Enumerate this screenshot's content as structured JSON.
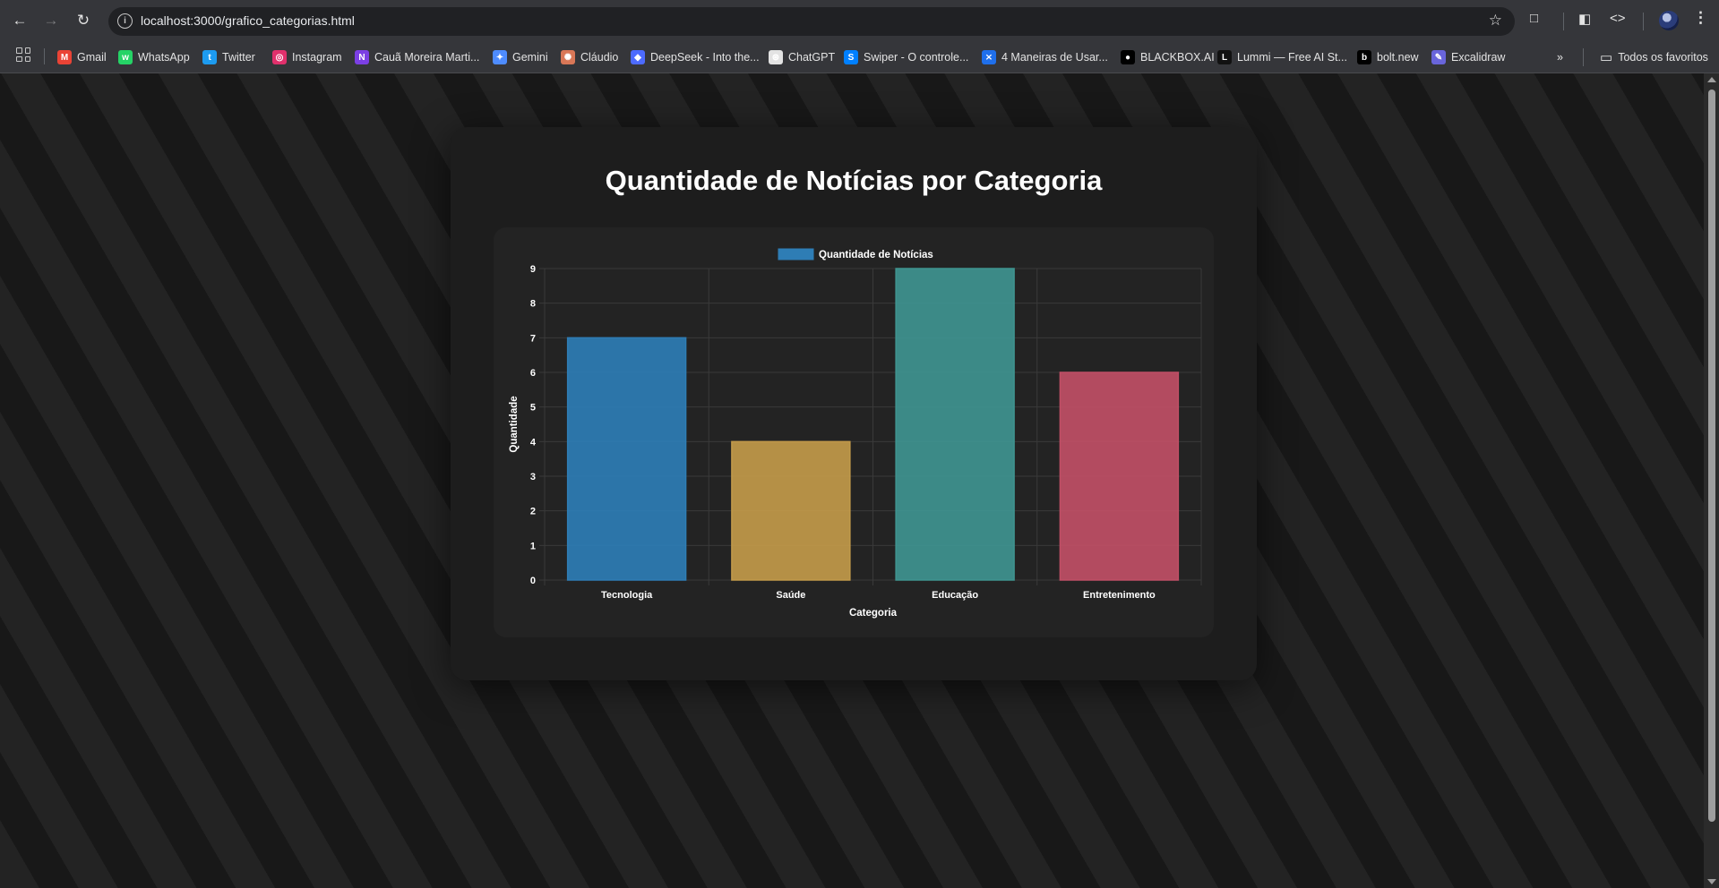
{
  "browser": {
    "url": "localhost:3000/grafico_categorias.html",
    "bookmarks": [
      {
        "label": "Gmail",
        "icon": "gmail-icon",
        "color": "#ea4335"
      },
      {
        "label": "WhatsApp",
        "icon": "whatsapp-icon",
        "color": "#25d366"
      },
      {
        "label": "Twitter",
        "icon": "twitter-icon",
        "color": "#1d9bf0"
      },
      {
        "label": "Instagram",
        "icon": "instagram-icon",
        "color": "#e1306c"
      },
      {
        "label": "Cauã Moreira Marti...",
        "icon": "notion-icon",
        "color": "#7b3fe4"
      },
      {
        "label": "Gemini",
        "icon": "gemini-icon",
        "color": "#4e8cff"
      },
      {
        "label": "Cláudio",
        "icon": "claude-icon",
        "color": "#d97757"
      },
      {
        "label": "DeepSeek - Into the...",
        "icon": "deepseek-icon",
        "color": "#4d6bfe"
      },
      {
        "label": "ChatGPT",
        "icon": "chatgpt-icon",
        "color": "#e3e3e3"
      },
      {
        "label": "Swiper - O controle...",
        "icon": "swiper-icon",
        "color": "#0080ff"
      },
      {
        "label": "4 Maneiras de Usar...",
        "icon": "app-icon",
        "color": "#1f6feb"
      },
      {
        "label": "BLACKBOX.AI",
        "icon": "blackbox-icon",
        "color": "#000000"
      },
      {
        "label": "Lummi — Free AI St...",
        "icon": "lummi-icon",
        "color": "#111111"
      },
      {
        "label": "bolt.new",
        "icon": "bolt-icon",
        "color": "#000000"
      },
      {
        "label": "Excalidraw",
        "icon": "excalidraw-icon",
        "color": "#6965db"
      }
    ],
    "all_bookmarks_label": "Todos os favoritos"
  },
  "page": {
    "title": "Quantidade de Notícias por Categoria"
  },
  "chart_data": {
    "type": "bar",
    "categories": [
      "Tecnologia",
      "Saúde",
      "Educação",
      "Entretenimento"
    ],
    "series": [
      {
        "name": "Quantidade de Notícias",
        "values": [
          7,
          4,
          9,
          6
        ]
      }
    ],
    "bar_colors": [
      "#2e7db5",
      "#c29a4a",
      "#3f9490",
      "#c04f66"
    ],
    "legend_color": "#2e7db5",
    "xlabel": "Categoria",
    "ylabel": "Quantidade",
    "ylim": [
      0,
      9
    ],
    "yticks": [
      "0",
      "1",
      "2",
      "3",
      "4",
      "5",
      "6",
      "7",
      "8",
      "9"
    ],
    "grid": true,
    "legend_position": "top"
  }
}
